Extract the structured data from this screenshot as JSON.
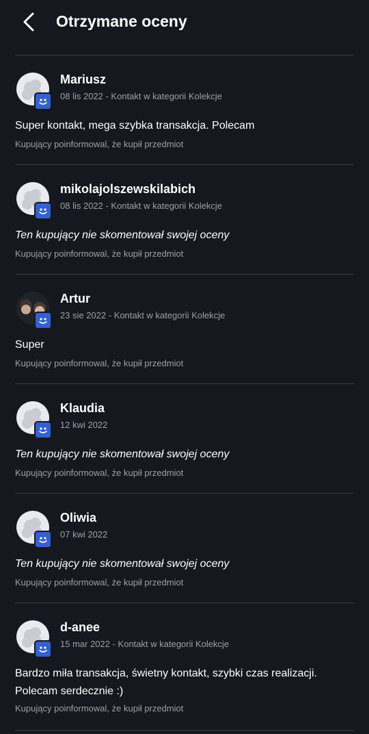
{
  "header": {
    "title": "Otrzymane oceny",
    "back_icon": "chevron-left-icon"
  },
  "colors": {
    "background": "#15181f",
    "badge": "#3460d0",
    "divider": "#3a3d45",
    "muted": "#9ca0a8"
  },
  "reviews": [
    {
      "name": "Mariusz",
      "meta": "08 lis 2022 - Kontakt w kategorii Kolekcje",
      "comment": "Super kontakt, mega szybka transakcja. Polecam",
      "info": "Kupujący poinformowal, że kupił przedmiot"
    },
    {
      "name": "mikolajolszewskilabich",
      "meta": "08 lis 2022 - Kontakt w kategorii Kolekcje",
      "comment": "Ten kupujący nie skomentował swojej oceny",
      "info": "Kupujący poinformowal, że kupił przedmiot"
    },
    {
      "name": "Artur",
      "meta": "23 sie 2022 - Kontakt w kategorii Kolekcje",
      "comment": "Super",
      "info": "Kupujący poinformowal, że kupił przedmiot"
    },
    {
      "name": "Klaudia",
      "meta": "12 kwi 2022",
      "comment": "Ten kupujący nie skomentował swojej oceny",
      "info": "Kupujący poinformowal, że kupił przedmiot"
    },
    {
      "name": "Oliwia",
      "meta": "07 kwi 2022",
      "comment": "Ten kupujący nie skomentował swojej oceny",
      "info": "Kupujący poinformowal, że kupił przedmiot"
    },
    {
      "name": "d-anee",
      "meta": "15 mar 2022 - Kontakt w kategorii Kolekcje",
      "comment": "Bardzo miła transakcja, świetny kontakt, szybki czas realizacji. Polecam serdecznie :)",
      "info": "Kupujący poinformowal, że kupił przedmiot"
    }
  ]
}
